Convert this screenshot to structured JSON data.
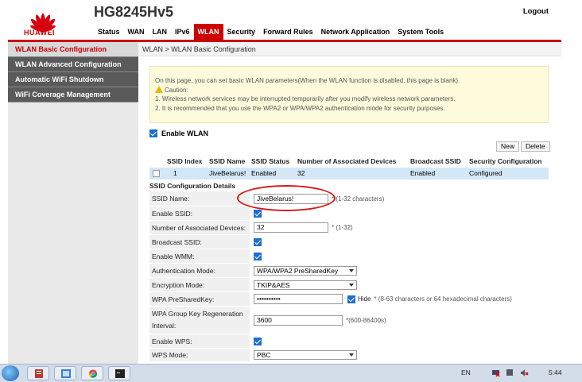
{
  "header": {
    "brand": "HUAWEI",
    "model": "HG8245Hv5",
    "logout_label": "Logout",
    "nav": [
      "Status",
      "WAN",
      "LAN",
      "IPv6",
      "WLAN",
      "Security",
      "Forward Rules",
      "Network Application",
      "System Tools"
    ],
    "active_nav": "WLAN"
  },
  "sidebar": {
    "items": [
      {
        "label": "WLAN Basic Configuration",
        "active": true
      },
      {
        "label": "WLAN Advanced Configuration",
        "active": false
      },
      {
        "label": "Automatic WiFi Shutdown",
        "active": false
      },
      {
        "label": "WiFi Coverage Management",
        "active": false
      }
    ]
  },
  "main": {
    "breadcrumb": "WLAN > WLAN Basic Configuration",
    "notice": {
      "line1": "On this page, you can set basic WLAN parameters(When the WLAN function is disabled, this page is blank).",
      "caution": "Caution:",
      "line2": "1. Wireless network services may be interrupted temporarily after you modify wireless network parameters.",
      "line3": "2. It is recommended that you use the WPA2 or WPA/WPA2 authentication mode for security purposes."
    },
    "enable_wlan_label": "Enable WLAN",
    "new_button": "New",
    "delete_button": "Delete",
    "ssid_table": {
      "headers": [
        "SSID Index",
        "SSID Name",
        "SSID Status",
        "Number of Associated Devices",
        "Broadcast SSID",
        "Security Configuration"
      ],
      "rows": [
        [
          "1",
          "JiveBelarus!",
          "Enabled",
          "32",
          "Enabled",
          "Configured"
        ]
      ]
    },
    "section_title": "SSID Configuration Details",
    "form": {
      "ssid_name_label": "SSID Name:",
      "ssid_name_value": "JiveBelarus!",
      "ssid_name_hint": "* (1-32 characters)",
      "enable_ssid_label": "Enable SSID:",
      "assoc_devices_label": "Number of Associated Devices:",
      "assoc_devices_value": "32",
      "assoc_devices_hint": "* (1-32)",
      "broadcast_ssid_label": "Broadcast SSID:",
      "enable_wmm_label": "Enable WMM:",
      "auth_mode_label": "Authentication Mode:",
      "auth_mode_value": "WPA/WPA2 PreSharedKey",
      "encryption_label": "Encryption Mode:",
      "encryption_value": "TKIP&AES",
      "psk_label": "WPA PreSharedKey:",
      "psk_value": "••••••••••",
      "hide_label": "Hide",
      "psk_hint": "* (8-63 characters or 64 hexadecimal characters)",
      "regen_label": "WPA Group Key Regeneration Interval:",
      "regen_value": "3600",
      "regen_hint": "*(600-86400s)",
      "enable_wps_label": "Enable WPS:",
      "wps_mode_label": "WPS Mode:",
      "wps_mode_value": "PBC"
    }
  },
  "taskbar": {
    "lang": "EN",
    "time": "5:44"
  },
  "colors": {
    "accent": "#cc0000",
    "sidebar_bg": "#5a5a5a",
    "checkbox": "#1d6fd1",
    "notice_bg": "#fdfbdc",
    "selected_row": "#d4e7f7"
  }
}
